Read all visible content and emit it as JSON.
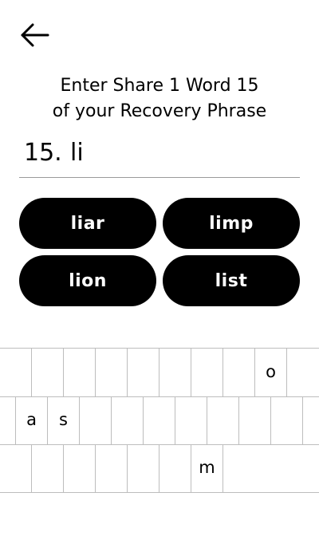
{
  "header": {
    "back_icon": "arrow-left-icon"
  },
  "prompt": {
    "line1": "Enter Share 1 Word 15",
    "line2": "of your Recovery Phrase"
  },
  "entry": {
    "number": "15.",
    "value": "li"
  },
  "suggestions": [
    {
      "label": "liar"
    },
    {
      "label": "limp"
    },
    {
      "label": "lion"
    },
    {
      "label": "list"
    }
  ],
  "keyboard": {
    "row1": [
      "",
      "",
      "",
      "",
      "",
      "",
      "",
      "",
      "o",
      ""
    ],
    "row2": [
      "",
      "a",
      "s",
      "",
      "",
      "",
      "",
      "",
      "",
      ""
    ],
    "row3": [
      "",
      "",
      "",
      "",
      "",
      "",
      "m",
      "",
      "",
      ""
    ]
  }
}
